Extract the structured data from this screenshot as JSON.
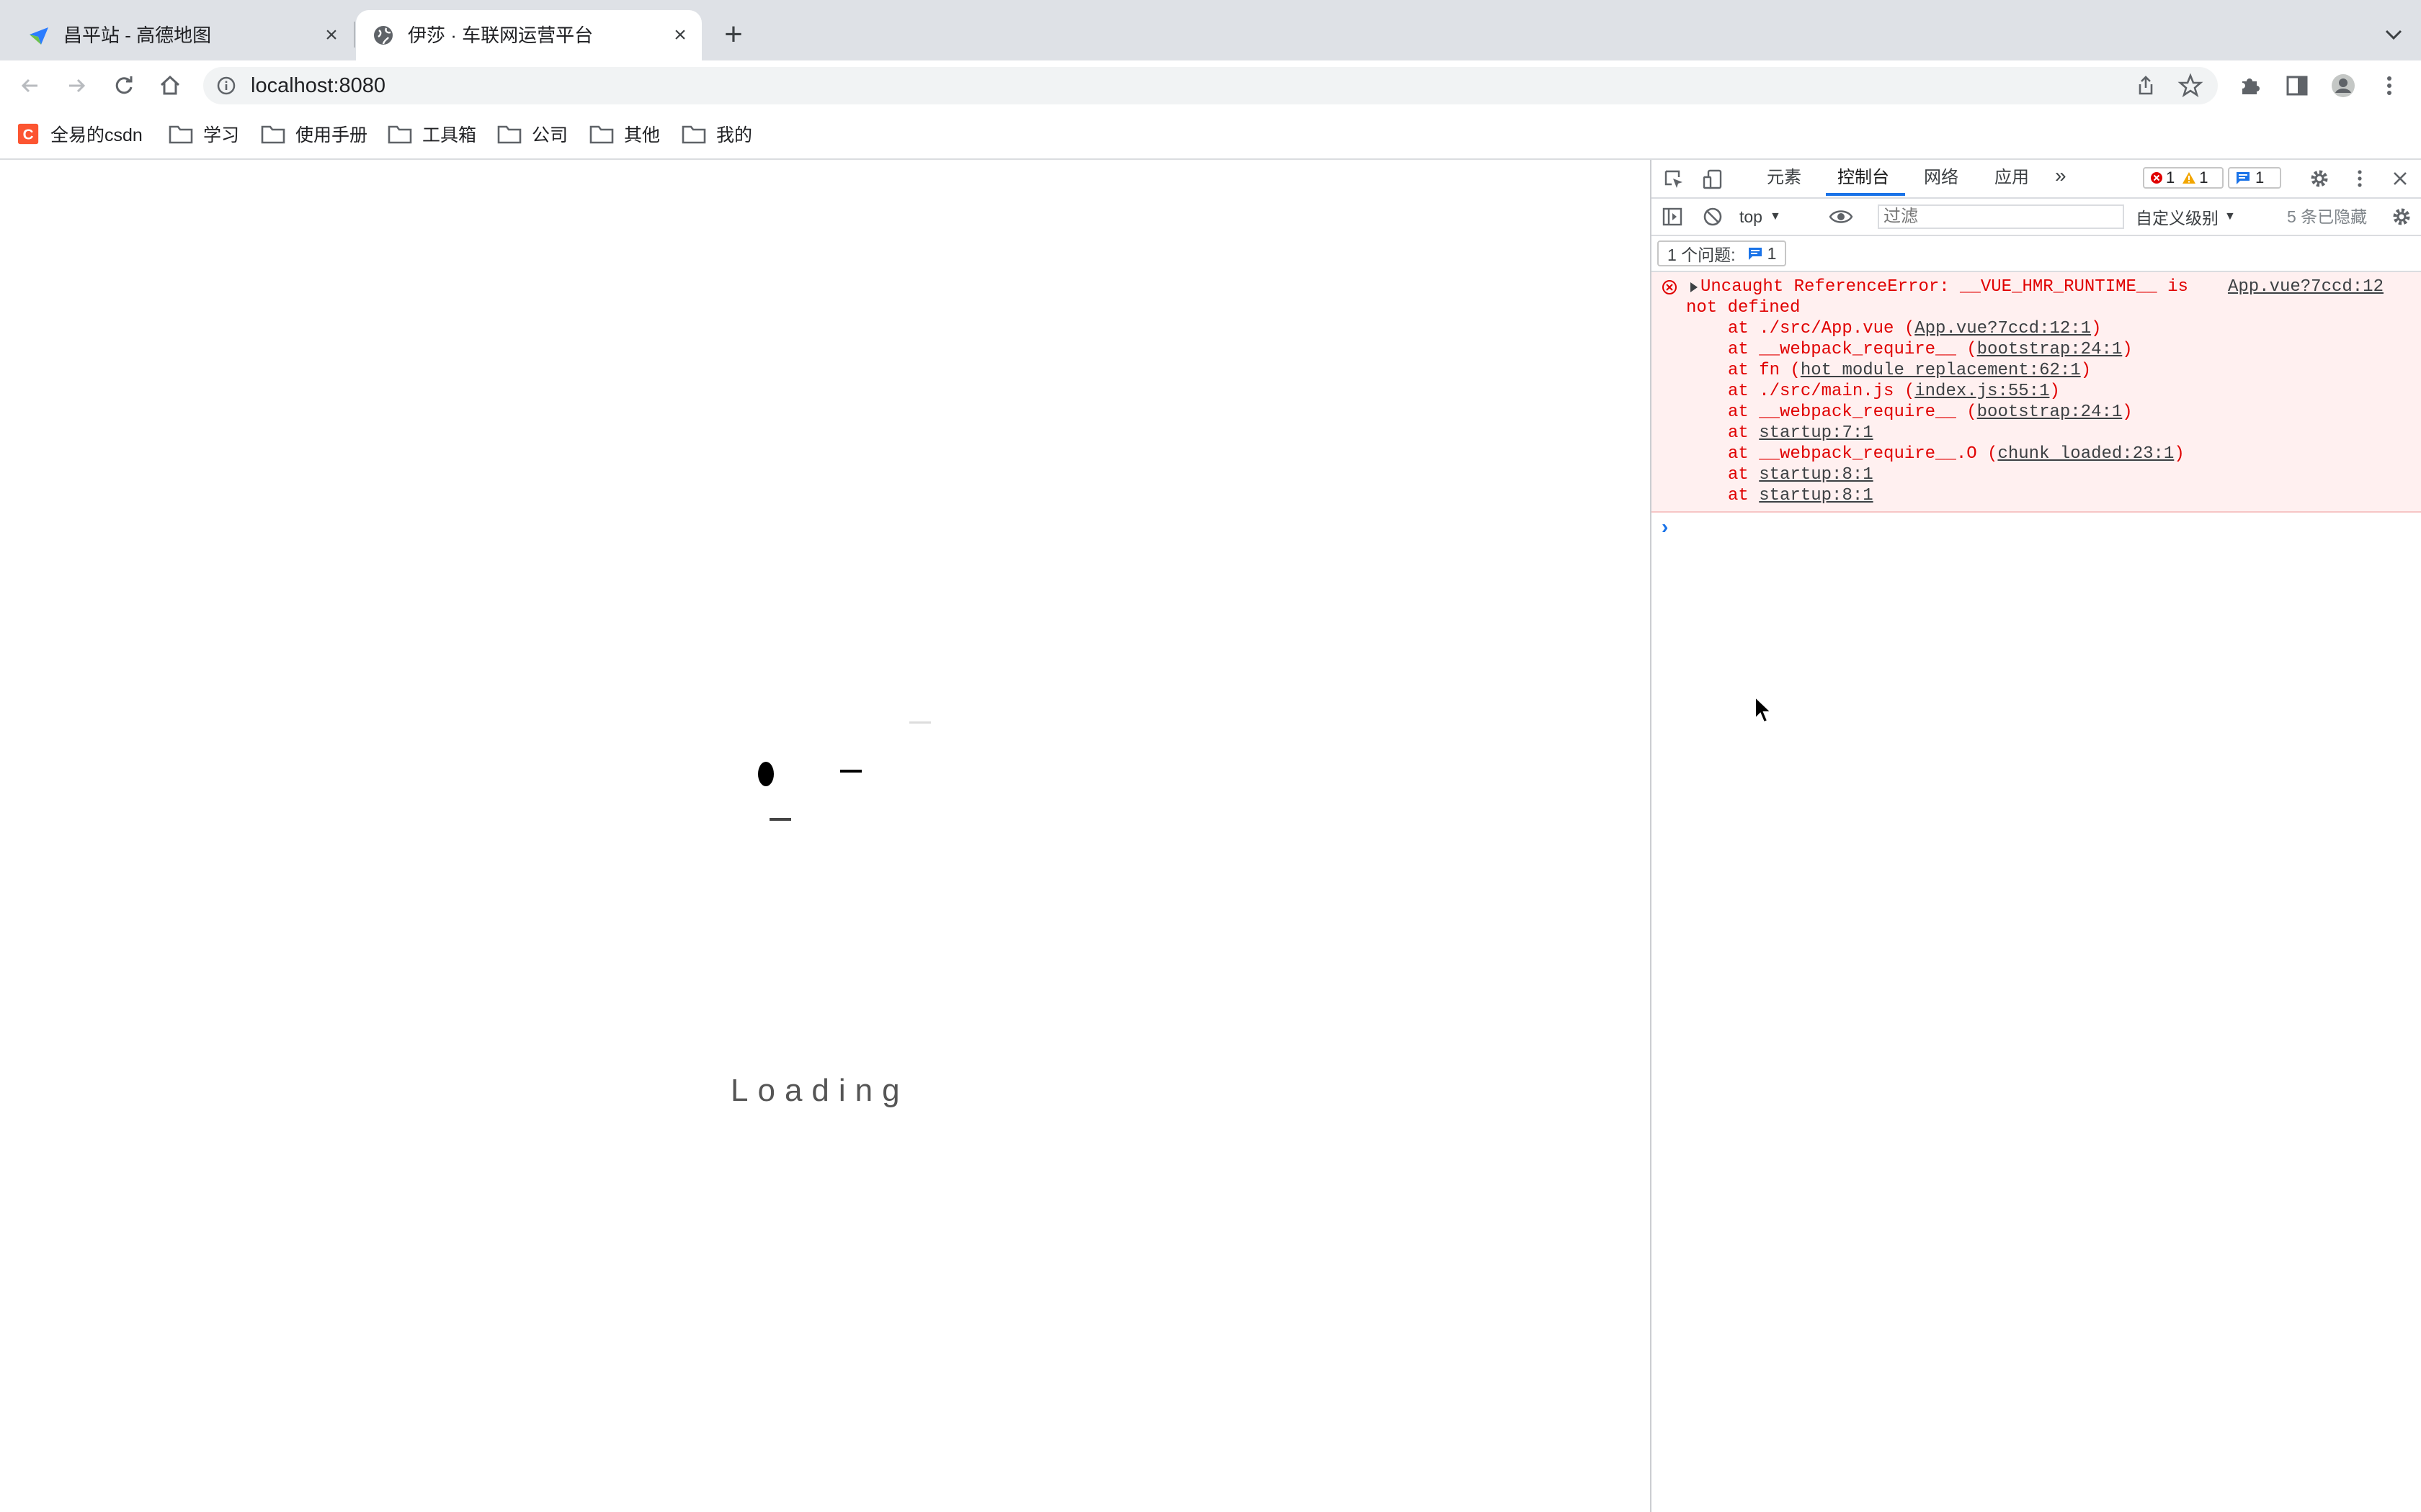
{
  "tabs": [
    {
      "title": "昌平站 - 高德地图",
      "favicon": "amap-icon",
      "active": false
    },
    {
      "title": "伊莎 · 车联网运营平台",
      "favicon": "globe-icon",
      "active": true
    }
  ],
  "toolbar": {
    "url": "localhost:8080"
  },
  "bookmarks": [
    {
      "label": "全易的csdn",
      "icon": "csdn-icon"
    },
    {
      "label": "学习",
      "icon": "folder-icon"
    },
    {
      "label": "使用手册",
      "icon": "folder-icon"
    },
    {
      "label": "工具箱",
      "icon": "folder-icon"
    },
    {
      "label": "公司",
      "icon": "folder-icon"
    },
    {
      "label": "其他",
      "icon": "folder-icon"
    },
    {
      "label": "我的",
      "icon": "folder-icon"
    }
  ],
  "page": {
    "loading_text": "Loading"
  },
  "devtools": {
    "tabs": [
      "元素",
      "控制台",
      "网络",
      "应用"
    ],
    "active_tab": "控制台",
    "badges": {
      "errors": "1",
      "warnings": "1",
      "messages": "1"
    },
    "context": "top",
    "filter_placeholder": "过滤",
    "level": "自定义级别",
    "hidden_count": "5 条已隐藏",
    "issues_label": "1 个问题:",
    "issues_count": "1",
    "error": {
      "message_line1": "Uncaught ReferenceError: __VUE_HMR_RUNTIME__ is",
      "message_line2": "not defined",
      "source": "App.vue?7ccd:12",
      "frames": [
        {
          "pre": "at ./src/App.vue (",
          "link": "App.vue?7ccd:12:1",
          "post": ")"
        },
        {
          "pre": "at __webpack_require__ (",
          "link": "bootstrap:24:1",
          "post": ")"
        },
        {
          "pre": "at fn (",
          "link": "hot module replacement:62:1",
          "post": ")"
        },
        {
          "pre": "at ./src/main.js (",
          "link": "index.js:55:1",
          "post": ")"
        },
        {
          "pre": "at __webpack_require__ (",
          "link": "bootstrap:24:1",
          "post": ")"
        },
        {
          "pre": "at ",
          "link": "startup:7:1",
          "post": ""
        },
        {
          "pre": "at __webpack_require__.O (",
          "link": "chunk loaded:23:1",
          "post": ")"
        },
        {
          "pre": "at ",
          "link": "startup:8:1",
          "post": ""
        },
        {
          "pre": "at ",
          "link": "startup:8:1",
          "post": ""
        }
      ]
    }
  },
  "colors": {
    "accent": "#1a73e8",
    "error": "#e00000",
    "error_bg": "#fff0f0"
  }
}
